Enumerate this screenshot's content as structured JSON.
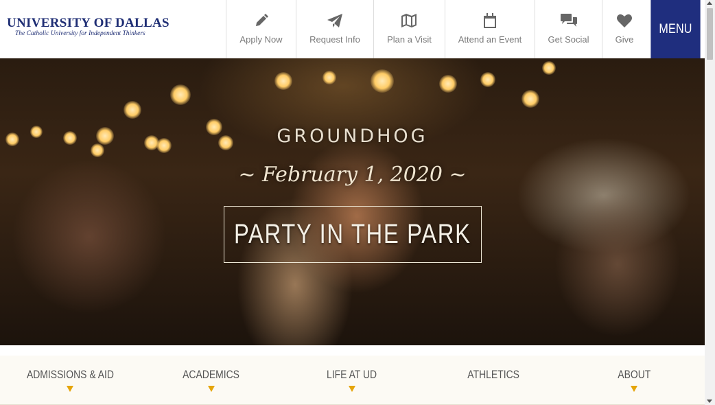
{
  "logo": {
    "title": "UNIVERSITY OF DALLAS",
    "subtitle": "The Catholic University for Independent Thinkers"
  },
  "quick_links": [
    {
      "label": "Apply Now",
      "icon": "pencil-icon"
    },
    {
      "label": "Request Info",
      "icon": "paper-plane-icon"
    },
    {
      "label": "Plan a Visit",
      "icon": "map-icon"
    },
    {
      "label": "Attend an Event",
      "icon": "calendar-icon"
    },
    {
      "label": "Get Social",
      "icon": "chat-bubbles-icon"
    },
    {
      "label": "Give",
      "icon": "heart-icon"
    }
  ],
  "menu": {
    "label": "MENU"
  },
  "hero": {
    "line1": "GROUNDHOG",
    "line2": "~ February 1, 2020 ~",
    "title": "PARTY IN THE PARK"
  },
  "main_nav": [
    {
      "label": "ADMISSIONS & AID",
      "has_dropdown": true
    },
    {
      "label": "ACADEMICS",
      "has_dropdown": true
    },
    {
      "label": "LIFE AT UD",
      "has_dropdown": true
    },
    {
      "label": "ATHLETICS",
      "has_dropdown": false
    },
    {
      "label": "ABOUT",
      "has_dropdown": true
    }
  ],
  "colors": {
    "brand_navy": "#1f2e7e",
    "accent_gold": "#e5a50a"
  }
}
